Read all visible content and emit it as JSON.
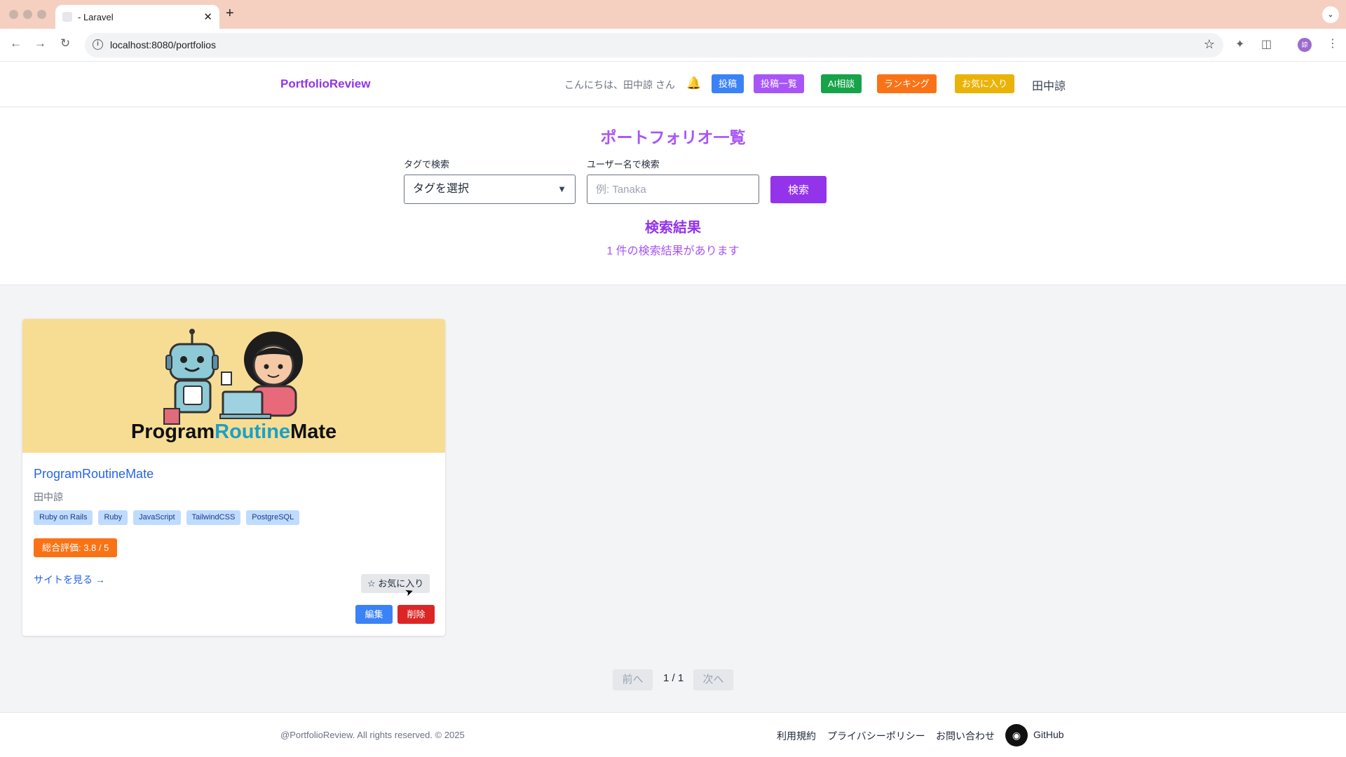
{
  "browser": {
    "tab_title": "- Laravel",
    "tab_close": "✕",
    "new_tab": "+",
    "url": "localhost:8080/portfolios",
    "profile_initial": "諒"
  },
  "header": {
    "logo": "PortfolioReview",
    "greeting": "こんにちは、田中諒 さん",
    "nav": {
      "post": "投稿",
      "post_list": "投稿一覧",
      "ai": "AI相談",
      "ranking": "ランキング",
      "favorites": "お気に入り"
    },
    "username": "田中諒",
    "colors": {
      "post": "#3b82f6",
      "post_list": "#a855f7",
      "ai": "#16a34a",
      "ranking": "#f97316",
      "favorites": "#eab308"
    }
  },
  "search": {
    "title": "ポートフォリオ一覧",
    "tag_label": "タグで検索",
    "tag_select_value": "タグを選択",
    "user_label": "ユーザー名で検索",
    "user_placeholder": "例: Tanaka",
    "button": "検索",
    "results_title": "検索結果",
    "results_count": "1 件の検索結果があります"
  },
  "portfolios": [
    {
      "image_text_1": "Program",
      "image_text_2": "Routine",
      "image_text_3": "Mate",
      "title": "ProgramRoutineMate",
      "author": "田中諒",
      "tags": [
        "Ruby on Rails",
        "Ruby",
        "JavaScript",
        "TailwindCSS",
        "PostgreSQL"
      ],
      "rating": "総合評価: 3.8 / 5",
      "site_link": "サイトを見る →",
      "favorite_button": "☆ お気に入り",
      "edit": "編集",
      "delete": "削除"
    }
  ],
  "pagination": {
    "prev": "前へ",
    "info": "1 / 1",
    "next": "次へ"
  },
  "footer": {
    "copyright": "@PortfolioReview. All rights reserved. © 2025",
    "terms": "利用規約",
    "privacy": "プライバシーポリシー",
    "contact": "お問い合わせ",
    "github": "GitHub"
  }
}
